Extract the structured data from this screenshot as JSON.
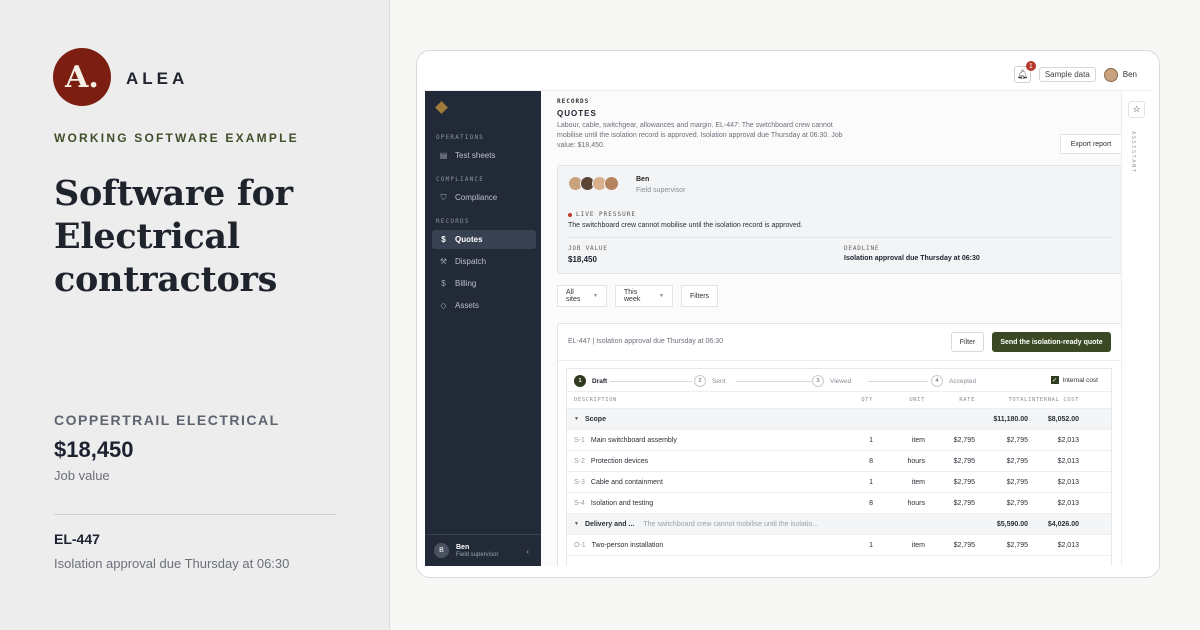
{
  "brand": {
    "logo_letter": "A.",
    "name": "ALEA",
    "color": "#7c1f12"
  },
  "hero": {
    "kicker": "WORKING SOFTWARE EXAMPLE",
    "headline": "Software for Electrical contractors",
    "company": "COPPERTRAIL ELECTRICAL",
    "job_value": "$18,450",
    "job_value_label": "Job value",
    "job_id": "EL-447",
    "job_note": "Isolation approval due Thursday at 06:30"
  },
  "topbar": {
    "notifications": "1",
    "sample_label": "Sample data",
    "user": "Ben"
  },
  "sidebar": {
    "sections": [
      {
        "label": "OPERATIONS",
        "items": [
          {
            "label": "Test sheets",
            "icon": "clipboard-icon"
          }
        ]
      },
      {
        "label": "COMPLIANCE",
        "items": [
          {
            "label": "Compliance",
            "icon": "shield-icon"
          }
        ]
      },
      {
        "label": "RECORDS",
        "items": [
          {
            "label": "Quotes",
            "icon": "dollar-icon",
            "active": true
          },
          {
            "label": "Dispatch",
            "icon": "wrench-icon"
          },
          {
            "label": "Billing",
            "icon": "dollar-icon"
          },
          {
            "label": "Assets",
            "icon": "box-icon"
          }
        ]
      }
    ],
    "footer": {
      "initial": "B",
      "name": "Ben",
      "role": "Field supervisor"
    }
  },
  "page": {
    "kicker": "RECORDS",
    "title": "QUOTES",
    "description": "Labour, cable, switchgear, allowances and margin. EL-447: The switchboard crew cannot mobilise until the isolation record is approved. Isolation approval due Thursday at 06:30. Job value: $18,450.",
    "export_label": "Export report"
  },
  "summary": {
    "name": "Ben",
    "role": "Field supervisor",
    "pressure_label": "LIVE PRESSURE",
    "pressure_text": "The switchboard crew cannot mobilise until the isolation record is approved.",
    "job_value_label": "JOB VALUE",
    "job_value": "$18,450",
    "deadline_label": "DEADLINE",
    "deadline": "Isolation approval due Thursday at 06:30"
  },
  "filters": [
    "All sites",
    "This week",
    "Filters"
  ],
  "quote": {
    "title": "EL-447 | Isolation approval due Thursday at 06:30",
    "filter_label": "Filter",
    "send_label": "Send the isolation-ready quote",
    "steps": [
      {
        "n": "1",
        "label": "Draft"
      },
      {
        "n": "2",
        "label": "Sent"
      },
      {
        "n": "3",
        "label": "Viewed"
      },
      {
        "n": "4",
        "label": "Accepted"
      }
    ],
    "internal_cost_label": "Internal cost",
    "headers": {
      "description": "DESCRIPTION",
      "qty": "QTY",
      "unit": "UNIT",
      "rate": "RATE",
      "total": "TOTAL",
      "internal": "INTERNAL COST"
    },
    "groups": [
      {
        "name": "Scope",
        "total": "$11,180.00",
        "internal": "$8,052.00",
        "note": "",
        "rows": [
          {
            "code": "S-1",
            "desc": "Main switchboard assembly",
            "qty": "1",
            "unit": "item",
            "rate": "$2,795",
            "total": "$2,795",
            "internal": "$2,013"
          },
          {
            "code": "S-2",
            "desc": "Protection devices",
            "qty": "8",
            "unit": "hours",
            "rate": "$2,795",
            "total": "$2,795",
            "internal": "$2,013"
          },
          {
            "code": "S-3",
            "desc": "Cable and containment",
            "qty": "1",
            "unit": "item",
            "rate": "$2,795",
            "total": "$2,795",
            "internal": "$2,013"
          },
          {
            "code": "S-4",
            "desc": "Isolation and testing",
            "qty": "8",
            "unit": "hours",
            "rate": "$2,795",
            "total": "$2,795",
            "internal": "$2,013"
          }
        ]
      },
      {
        "name": "Delivery and ...",
        "total": "$5,590.00",
        "internal": "$4,026.00",
        "note": "The switchboard crew cannot mobilise until the isolatio...",
        "rows": [
          {
            "code": "O-1",
            "desc": "Two-person installation",
            "qty": "1",
            "unit": "item",
            "rate": "$2,795",
            "total": "$2,795",
            "internal": "$2,013"
          }
        ]
      }
    ]
  },
  "assistant_label": "ASSISTANT"
}
